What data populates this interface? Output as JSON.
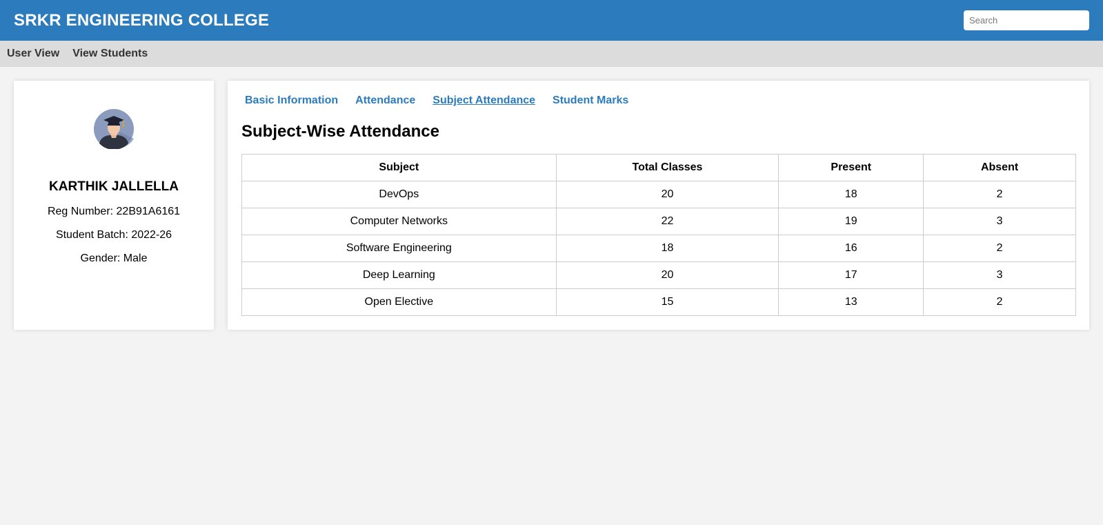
{
  "header": {
    "title": "SRKR ENGINEERING COLLEGE",
    "search_placeholder": "Search"
  },
  "nav": {
    "items": [
      "User View",
      "View Students"
    ]
  },
  "profile": {
    "avatar_icon": "graduate-avatar-icon",
    "name": "KARTHIK JALLELLA",
    "reg": "Reg Number: 22B91A6161",
    "batch": "Student Batch: 2022-26",
    "gender": "Gender: Male"
  },
  "tabs": [
    {
      "label": "Basic Information",
      "active": false
    },
    {
      "label": "Attendance",
      "active": false
    },
    {
      "label": "Subject Attendance",
      "active": true
    },
    {
      "label": "Student Marks",
      "active": false
    }
  ],
  "section_title": "Subject-Wise Attendance",
  "table": {
    "headers": [
      "Subject",
      "Total Classes",
      "Present",
      "Absent"
    ],
    "rows": [
      [
        "DevOps",
        "20",
        "18",
        "2"
      ],
      [
        "Computer Networks",
        "22",
        "19",
        "3"
      ],
      [
        "Software Engineering",
        "18",
        "16",
        "2"
      ],
      [
        "Deep Learning",
        "20",
        "17",
        "3"
      ],
      [
        "Open Elective",
        "15",
        "13",
        "2"
      ]
    ]
  },
  "colors": {
    "brand": "#2b7bbd",
    "navbar": "#dcdcdc",
    "background": "#f3f3f3"
  }
}
